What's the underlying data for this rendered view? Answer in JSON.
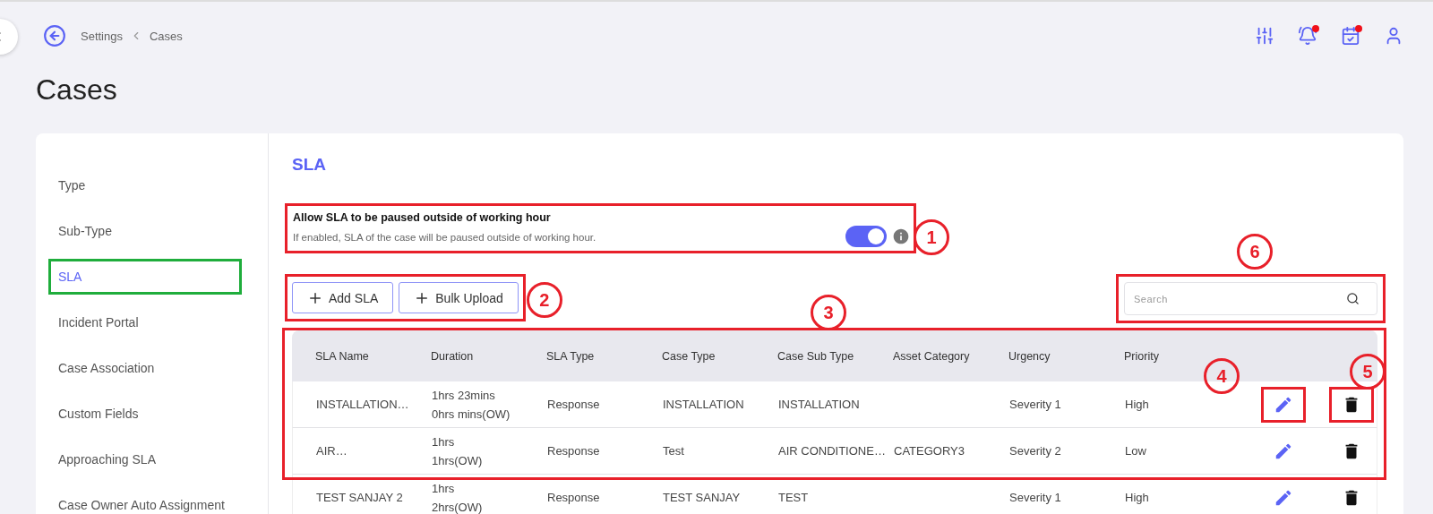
{
  "breadcrumb": [
    "Settings",
    "Cases"
  ],
  "header_icons": [
    {
      "kind": "filter",
      "badge": false
    },
    {
      "kind": "bell",
      "badge": true
    },
    {
      "kind": "calendar",
      "badge": true
    },
    {
      "kind": "user",
      "badge": false
    }
  ],
  "page_title": "Cases",
  "sidebar": {
    "items": [
      {
        "label": "Type",
        "selected": false,
        "highlighted": false
      },
      {
        "label": "Sub-Type",
        "selected": false,
        "highlighted": false
      },
      {
        "label": "SLA",
        "selected": true,
        "highlighted": true
      },
      {
        "label": "Incident Portal",
        "selected": false,
        "highlighted": false
      },
      {
        "label": "Case Association",
        "selected": false,
        "highlighted": false
      },
      {
        "label": "Custom Fields",
        "selected": false,
        "highlighted": false
      },
      {
        "label": "Approaching SLA",
        "selected": false,
        "highlighted": false
      },
      {
        "label": "Case Owner Auto Assignment",
        "selected": false,
        "highlighted": false
      }
    ]
  },
  "section_title": "SLA",
  "setting": {
    "title": "Allow SLA to be paused outside of working hour",
    "description": "If enabled, SLA of the case will be paused outside of working hour.",
    "on": true,
    "callout": "1"
  },
  "buttons": {
    "callout": "2",
    "items": [
      {
        "label": "Add SLA"
      },
      {
        "label": "Bulk Upload"
      }
    ]
  },
  "search": {
    "placeholder": "Search",
    "callout": "6"
  },
  "table": {
    "callout": "3",
    "columns": [
      "SLA Name",
      "Duration",
      "SLA Type",
      "Case Type",
      "Case Sub Type",
      "Asset Category",
      "Urgency",
      "Priority"
    ],
    "actions": [
      {
        "kind": "edit",
        "callout": "4"
      },
      {
        "kind": "delete",
        "callout": "5"
      }
    ],
    "rows": [
      {
        "cells": [
          "INSTALLATION…",
          "1hrs 23mins\n0hrs mins(OW)",
          "Response",
          "INSTALLATION",
          "INSTALLATION",
          null,
          "Severity 1",
          "High"
        ],
        "highlighted": true
      },
      {
        "cells": [
          "AIR…",
          "1hrs\n1hrs(OW)",
          "Response",
          "Test",
          "AIR CONDITIONE…",
          "CATEGORY3",
          "Severity 2",
          "Low"
        ],
        "highlighted": false
      },
      {
        "cells": [
          "TEST SANJAY 2",
          "1hrs\n2hrs(OW)",
          "Response",
          "TEST SANJAY",
          "TEST",
          null,
          "Severity 1",
          "High"
        ],
        "highlighted": false
      }
    ]
  }
}
